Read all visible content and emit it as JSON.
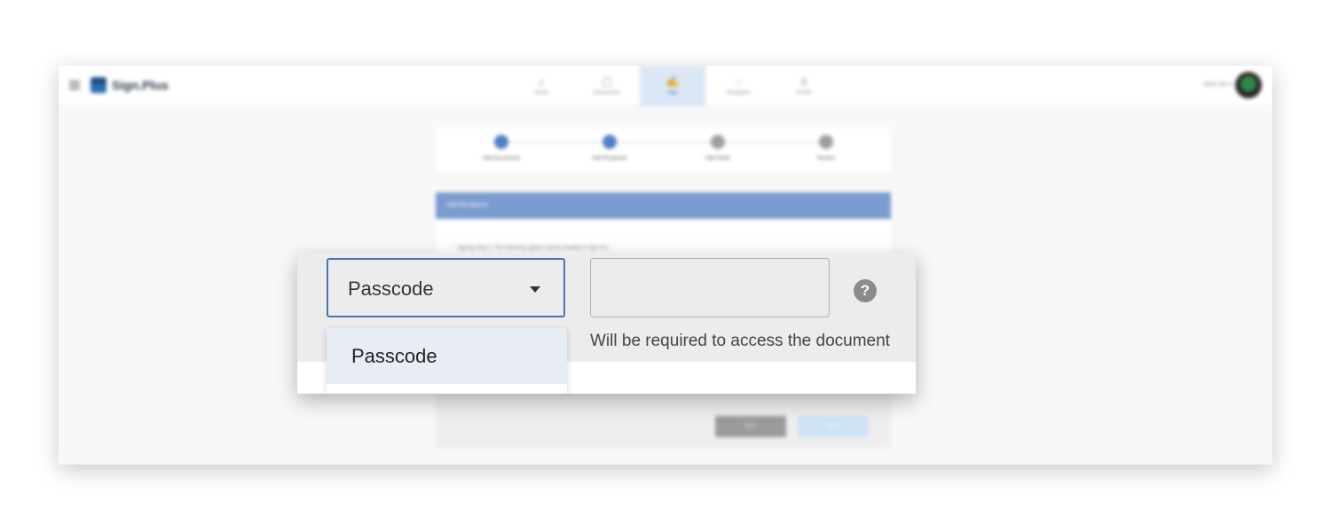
{
  "app": {
    "logo_text": "Sign.Plus",
    "user_name": "Alois SA ▾"
  },
  "nav": [
    {
      "label": "Home",
      "glyph": "⌂",
      "active": false
    },
    {
      "label": "Documents",
      "glyph": "▢",
      "active": false
    },
    {
      "label": "Sign",
      "glyph": "✍",
      "active": true
    },
    {
      "label": "Templates",
      "glyph": "◌",
      "active": false
    },
    {
      "label": "Profile",
      "glyph": "♙",
      "active": false
    }
  ],
  "stepper": {
    "steps": [
      {
        "label": "Add Documents",
        "status": "done"
      },
      {
        "label": "Add Recipients",
        "status": "current"
      },
      {
        "label": "Add Fields",
        "status": "pending"
      },
      {
        "label": "Review",
        "status": "pending"
      }
    ]
  },
  "recipients": {
    "header": "Add Recipients",
    "signing_step_text": "Signing Step 1: The following signers will be emailed to sign first",
    "back_label": "Back",
    "next_label": "Next"
  },
  "auth": {
    "select_value": "Passcode",
    "dropdown_options": [
      "Passcode"
    ],
    "passcode_value": "",
    "help_text": "Will be required to access the document",
    "help_icon": "?"
  },
  "colors": {
    "accent": "#4b74b8",
    "header_blue": "#7a9bd0",
    "option_highlight": "#e8edf5"
  }
}
